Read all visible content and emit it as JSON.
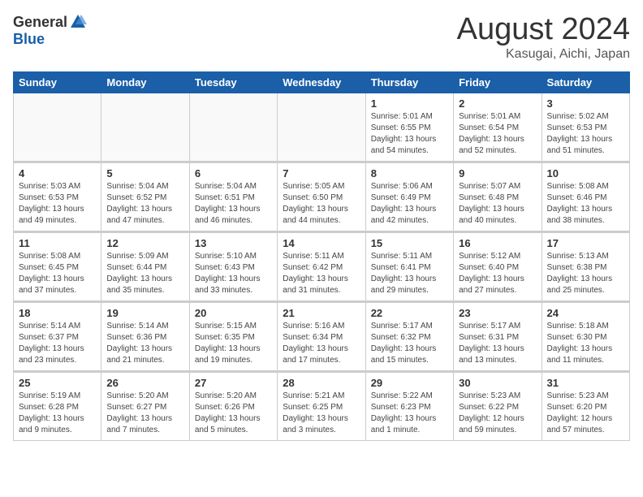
{
  "header": {
    "logo": {
      "general": "General",
      "blue": "Blue"
    },
    "title": "August 2024",
    "location": "Kasugai, Aichi, Japan"
  },
  "weekdays": [
    "Sunday",
    "Monday",
    "Tuesday",
    "Wednesday",
    "Thursday",
    "Friday",
    "Saturday"
  ],
  "weeks": [
    [
      {
        "day": "",
        "info": ""
      },
      {
        "day": "",
        "info": ""
      },
      {
        "day": "",
        "info": ""
      },
      {
        "day": "",
        "info": ""
      },
      {
        "day": "1",
        "info": "Sunrise: 5:01 AM\nSunset: 6:55 PM\nDaylight: 13 hours\nand 54 minutes."
      },
      {
        "day": "2",
        "info": "Sunrise: 5:01 AM\nSunset: 6:54 PM\nDaylight: 13 hours\nand 52 minutes."
      },
      {
        "day": "3",
        "info": "Sunrise: 5:02 AM\nSunset: 6:53 PM\nDaylight: 13 hours\nand 51 minutes."
      }
    ],
    [
      {
        "day": "4",
        "info": "Sunrise: 5:03 AM\nSunset: 6:53 PM\nDaylight: 13 hours\nand 49 minutes."
      },
      {
        "day": "5",
        "info": "Sunrise: 5:04 AM\nSunset: 6:52 PM\nDaylight: 13 hours\nand 47 minutes."
      },
      {
        "day": "6",
        "info": "Sunrise: 5:04 AM\nSunset: 6:51 PM\nDaylight: 13 hours\nand 46 minutes."
      },
      {
        "day": "7",
        "info": "Sunrise: 5:05 AM\nSunset: 6:50 PM\nDaylight: 13 hours\nand 44 minutes."
      },
      {
        "day": "8",
        "info": "Sunrise: 5:06 AM\nSunset: 6:49 PM\nDaylight: 13 hours\nand 42 minutes."
      },
      {
        "day": "9",
        "info": "Sunrise: 5:07 AM\nSunset: 6:48 PM\nDaylight: 13 hours\nand 40 minutes."
      },
      {
        "day": "10",
        "info": "Sunrise: 5:08 AM\nSunset: 6:46 PM\nDaylight: 13 hours\nand 38 minutes."
      }
    ],
    [
      {
        "day": "11",
        "info": "Sunrise: 5:08 AM\nSunset: 6:45 PM\nDaylight: 13 hours\nand 37 minutes."
      },
      {
        "day": "12",
        "info": "Sunrise: 5:09 AM\nSunset: 6:44 PM\nDaylight: 13 hours\nand 35 minutes."
      },
      {
        "day": "13",
        "info": "Sunrise: 5:10 AM\nSunset: 6:43 PM\nDaylight: 13 hours\nand 33 minutes."
      },
      {
        "day": "14",
        "info": "Sunrise: 5:11 AM\nSunset: 6:42 PM\nDaylight: 13 hours\nand 31 minutes."
      },
      {
        "day": "15",
        "info": "Sunrise: 5:11 AM\nSunset: 6:41 PM\nDaylight: 13 hours\nand 29 minutes."
      },
      {
        "day": "16",
        "info": "Sunrise: 5:12 AM\nSunset: 6:40 PM\nDaylight: 13 hours\nand 27 minutes."
      },
      {
        "day": "17",
        "info": "Sunrise: 5:13 AM\nSunset: 6:38 PM\nDaylight: 13 hours\nand 25 minutes."
      }
    ],
    [
      {
        "day": "18",
        "info": "Sunrise: 5:14 AM\nSunset: 6:37 PM\nDaylight: 13 hours\nand 23 minutes."
      },
      {
        "day": "19",
        "info": "Sunrise: 5:14 AM\nSunset: 6:36 PM\nDaylight: 13 hours\nand 21 minutes."
      },
      {
        "day": "20",
        "info": "Sunrise: 5:15 AM\nSunset: 6:35 PM\nDaylight: 13 hours\nand 19 minutes."
      },
      {
        "day": "21",
        "info": "Sunrise: 5:16 AM\nSunset: 6:34 PM\nDaylight: 13 hours\nand 17 minutes."
      },
      {
        "day": "22",
        "info": "Sunrise: 5:17 AM\nSunset: 6:32 PM\nDaylight: 13 hours\nand 15 minutes."
      },
      {
        "day": "23",
        "info": "Sunrise: 5:17 AM\nSunset: 6:31 PM\nDaylight: 13 hours\nand 13 minutes."
      },
      {
        "day": "24",
        "info": "Sunrise: 5:18 AM\nSunset: 6:30 PM\nDaylight: 13 hours\nand 11 minutes."
      }
    ],
    [
      {
        "day": "25",
        "info": "Sunrise: 5:19 AM\nSunset: 6:28 PM\nDaylight: 13 hours\nand 9 minutes."
      },
      {
        "day": "26",
        "info": "Sunrise: 5:20 AM\nSunset: 6:27 PM\nDaylight: 13 hours\nand 7 minutes."
      },
      {
        "day": "27",
        "info": "Sunrise: 5:20 AM\nSunset: 6:26 PM\nDaylight: 13 hours\nand 5 minutes."
      },
      {
        "day": "28",
        "info": "Sunrise: 5:21 AM\nSunset: 6:25 PM\nDaylight: 13 hours\nand 3 minutes."
      },
      {
        "day": "29",
        "info": "Sunrise: 5:22 AM\nSunset: 6:23 PM\nDaylight: 13 hours\nand 1 minute."
      },
      {
        "day": "30",
        "info": "Sunrise: 5:23 AM\nSunset: 6:22 PM\nDaylight: 12 hours\nand 59 minutes."
      },
      {
        "day": "31",
        "info": "Sunrise: 5:23 AM\nSunset: 6:20 PM\nDaylight: 12 hours\nand 57 minutes."
      }
    ]
  ]
}
